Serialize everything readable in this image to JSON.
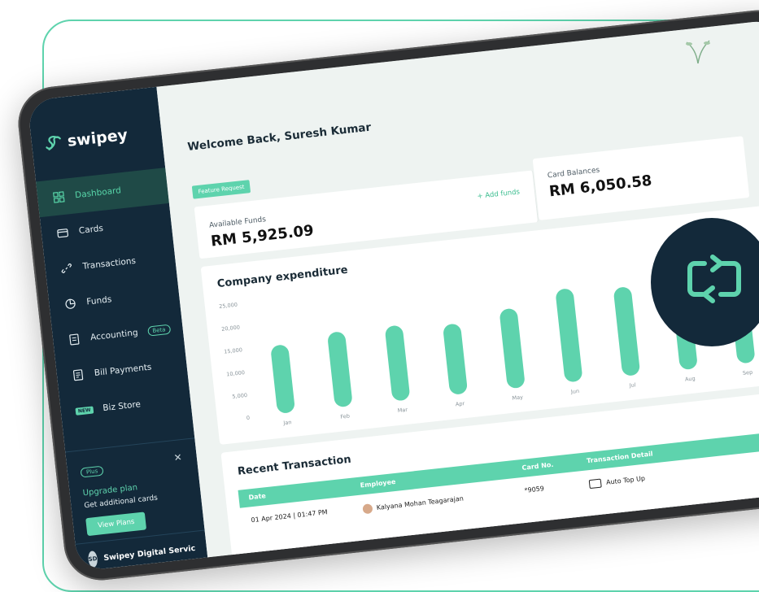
{
  "app": {
    "brand": "swipey"
  },
  "sidebar": {
    "items": [
      {
        "label": "Dashboard",
        "icon": "dashboard-grid-icon",
        "active": true
      },
      {
        "label": "Cards",
        "icon": "card-icon"
      },
      {
        "label": "Transactions",
        "icon": "link-icon"
      },
      {
        "label": "Funds",
        "icon": "pie-chart-icon"
      },
      {
        "label": "Accounting",
        "icon": "ledger-icon",
        "badge": "Beta"
      },
      {
        "label": "Bill Payments",
        "icon": "bill-icon"
      },
      {
        "label": "Biz Store",
        "icon": "store-icon",
        "badge": "NEW"
      }
    ],
    "upgrade": {
      "pill": "Plus",
      "title": "Upgrade plan",
      "subtitle": "Get additional cards",
      "button": "View Plans"
    },
    "company": {
      "name": "Swipey Digital Servic",
      "avatar_text": "SD"
    }
  },
  "header": {
    "welcome": "Welcome Back, Suresh Kumar"
  },
  "feature_request": "Feature Request",
  "available_funds": {
    "label": "Available Funds",
    "value": "RM 5,925.09",
    "add_label": "+ Add funds"
  },
  "card_balances": {
    "label": "Card Balances",
    "value": "RM 6,050.58"
  },
  "chart_title": "Company expenditure",
  "chart_data": {
    "type": "bar",
    "title": "Company expenditure",
    "categories": [
      "Jan",
      "Feb",
      "Mar",
      "Apr",
      "May",
      "Jun",
      "Jul",
      "Aug",
      "Sep"
    ],
    "values": [
      15000,
      16500,
      16500,
      15500,
      17500,
      20500,
      19500,
      19500,
      22500
    ],
    "yticks": [
      0,
      5000,
      10000,
      15000,
      20000,
      25000
    ],
    "ytick_labels": [
      "0",
      "5,000",
      "10,000",
      "15,000",
      "20,000",
      "25,000"
    ],
    "ylim": [
      0,
      25000
    ],
    "bar_color": "#5ed3ad",
    "grid": false
  },
  "recent": {
    "title": "Recent Transaction",
    "columns": [
      "Date",
      "Employee",
      "Card No.",
      "Transaction Detail"
    ],
    "rows": [
      {
        "date": "01 Apr 2024 | 01:47 PM",
        "employee": "Kalyana Mohan Teagarajan",
        "card": "*9059",
        "detail": "Auto Top Up"
      }
    ]
  },
  "colors": {
    "accent": "#5ed3ad",
    "sidebar_bg": "#13293a",
    "page_bg": "#eef3f1"
  }
}
